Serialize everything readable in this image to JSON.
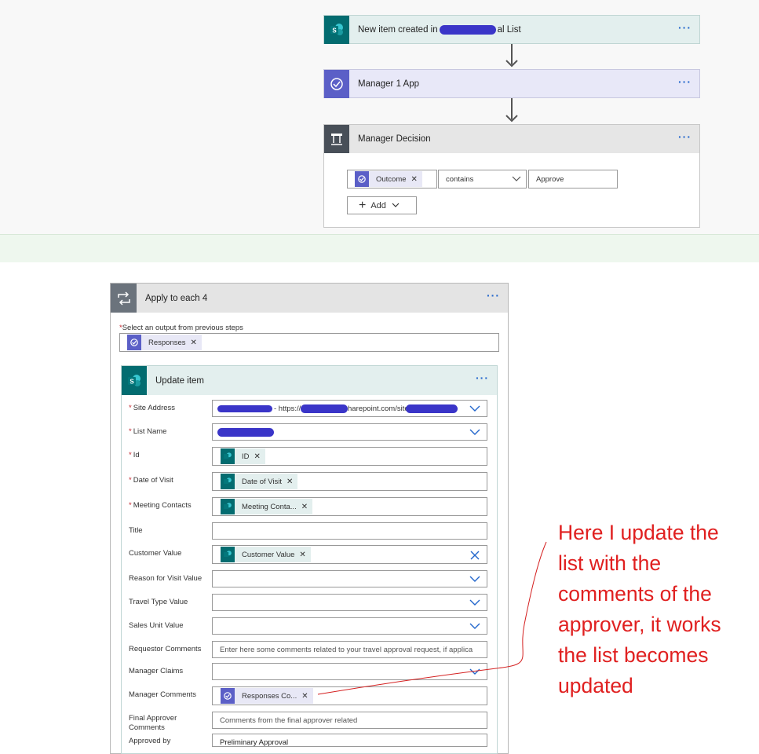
{
  "flow": {
    "trigger": {
      "title": "New item created in",
      "title_suffix": "al List",
      "icon": "sharepoint-icon",
      "color": "#036c70"
    },
    "app_step": {
      "title": "Manager 1 App",
      "icon": "approval-icon",
      "color": "#5b5fc7"
    },
    "condition": {
      "title": "Manager Decision",
      "icon": "condition-icon",
      "token": "Outcome",
      "operator": "contains",
      "value": "Approve",
      "add_label": "Add"
    }
  },
  "apply_each": {
    "title": "Apply to each 4",
    "select_label": "Select an output from previous steps",
    "select_token": "Responses"
  },
  "update_item": {
    "title": "Update item",
    "site_address_text": "- https://",
    "site_address_mid": "harepoint.com/sites",
    "fields": {
      "site_address": "Site Address",
      "list_name": "List Name",
      "id": "Id",
      "date_of_visit": "Date of Visit",
      "meeting_contacts": "Meeting Contacts",
      "title": "Title",
      "customer_value": "Customer Value",
      "reason_for_visit": "Reason for Visit Value",
      "travel_type": "Travel Type Value",
      "sales_unit": "Sales Unit Value",
      "requestor_comments": "Requestor Comments",
      "manager_claims": "Manager Claims",
      "manager_comments": "Manager Comments",
      "final_approver_1": "Final Approver",
      "final_approver_2": "Comments",
      "approved_by": "Approved by"
    },
    "tokens": {
      "id": "ID",
      "date_of_visit": "Date of Visit",
      "meeting_contacts": "Meeting Conta...",
      "customer_value": "Customer Value",
      "manager_comments": "Responses Co..."
    },
    "placeholders": {
      "requestor_comments": "Enter here some comments related to your travel approval request, if applica",
      "final_approver": "Comments from the final approver related",
      "approved_by": "Preliminary Approval"
    }
  },
  "annotation": {
    "line1": "Here I update the",
    "line2": "list with the",
    "line3": "comments of the",
    "line4": "approver, it works",
    "line5": "the list becomes",
    "line6": "updated"
  },
  "colors": {
    "accent": "#2266cc",
    "sharepoint": "#036c70",
    "approval": "#5b5fc7",
    "condition": "#484f58",
    "annotation": "#e02020"
  }
}
